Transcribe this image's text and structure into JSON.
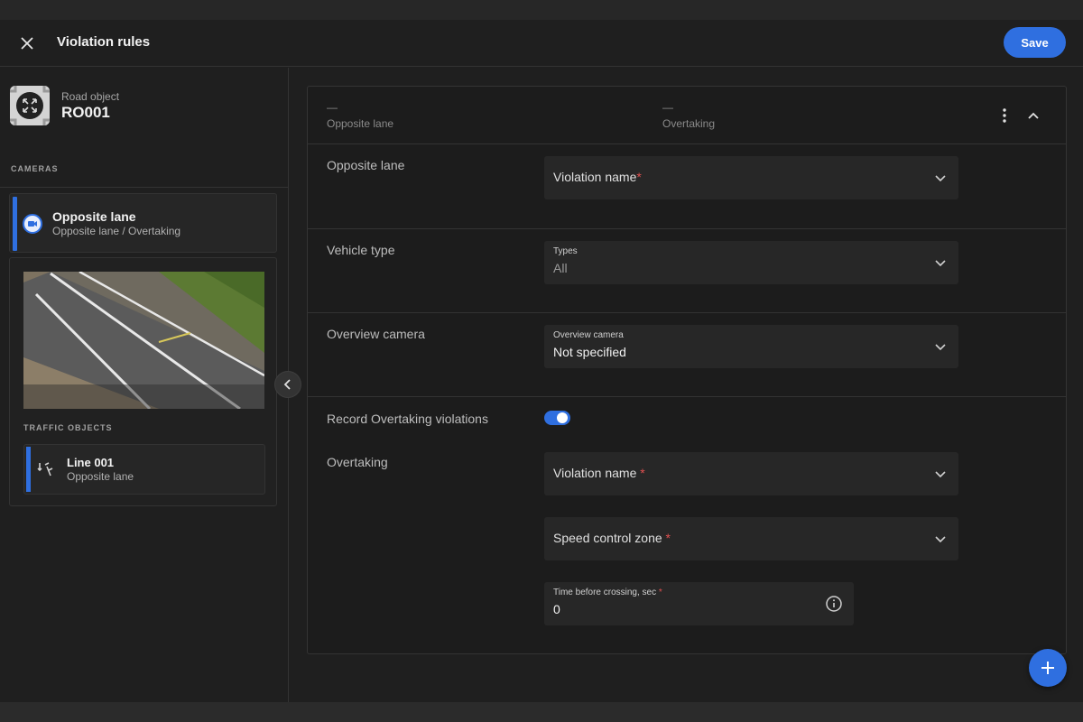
{
  "header": {
    "title": "Violation rules",
    "save_label": "Save"
  },
  "sidebar": {
    "road_object_label": "Road object",
    "road_object_id": "RO001",
    "cameras_heading": "CAMERAS",
    "camera": {
      "name": "Opposite lane",
      "subtitle": "Opposite lane / Overtaking"
    },
    "traffic_objects_heading": "TRAFFIC OBJECTS",
    "traffic_object": {
      "name": "Line 001",
      "subtitle": "Opposite lane"
    }
  },
  "rule": {
    "summary": [
      {
        "dash": "—",
        "label": "Opposite lane"
      },
      {
        "dash": "—",
        "label": "Overtaking"
      }
    ],
    "rows": {
      "opposite_lane_label": "Opposite lane",
      "vehicle_type_label": "Vehicle type",
      "overview_camera_label": "Overview camera",
      "record_overtaking_label": "Record Overtaking violations",
      "overtaking_label": "Overtaking"
    },
    "fields": {
      "violation_name_1": "Violation name",
      "types_label": "Types",
      "types_value": "All",
      "overview_camera_label": "Overview camera",
      "overview_camera_value": "Not specified",
      "violation_name_2": "Violation name ",
      "speed_control_zone": "Speed control zone ",
      "time_before_crossing_label": "Time before crossing, sec ",
      "time_before_crossing_value": "0",
      "required_mark": "*"
    },
    "record_overtaking_enabled": true
  },
  "colors": {
    "accent": "#2f6fe0",
    "required": "#e05050"
  },
  "icons": [
    "close-icon",
    "road-object-icon",
    "camera-icon",
    "line-icon",
    "chevron-left-icon",
    "kebab-icon",
    "chevron-up-icon",
    "chevron-down-icon",
    "info-icon",
    "plus-icon"
  ]
}
